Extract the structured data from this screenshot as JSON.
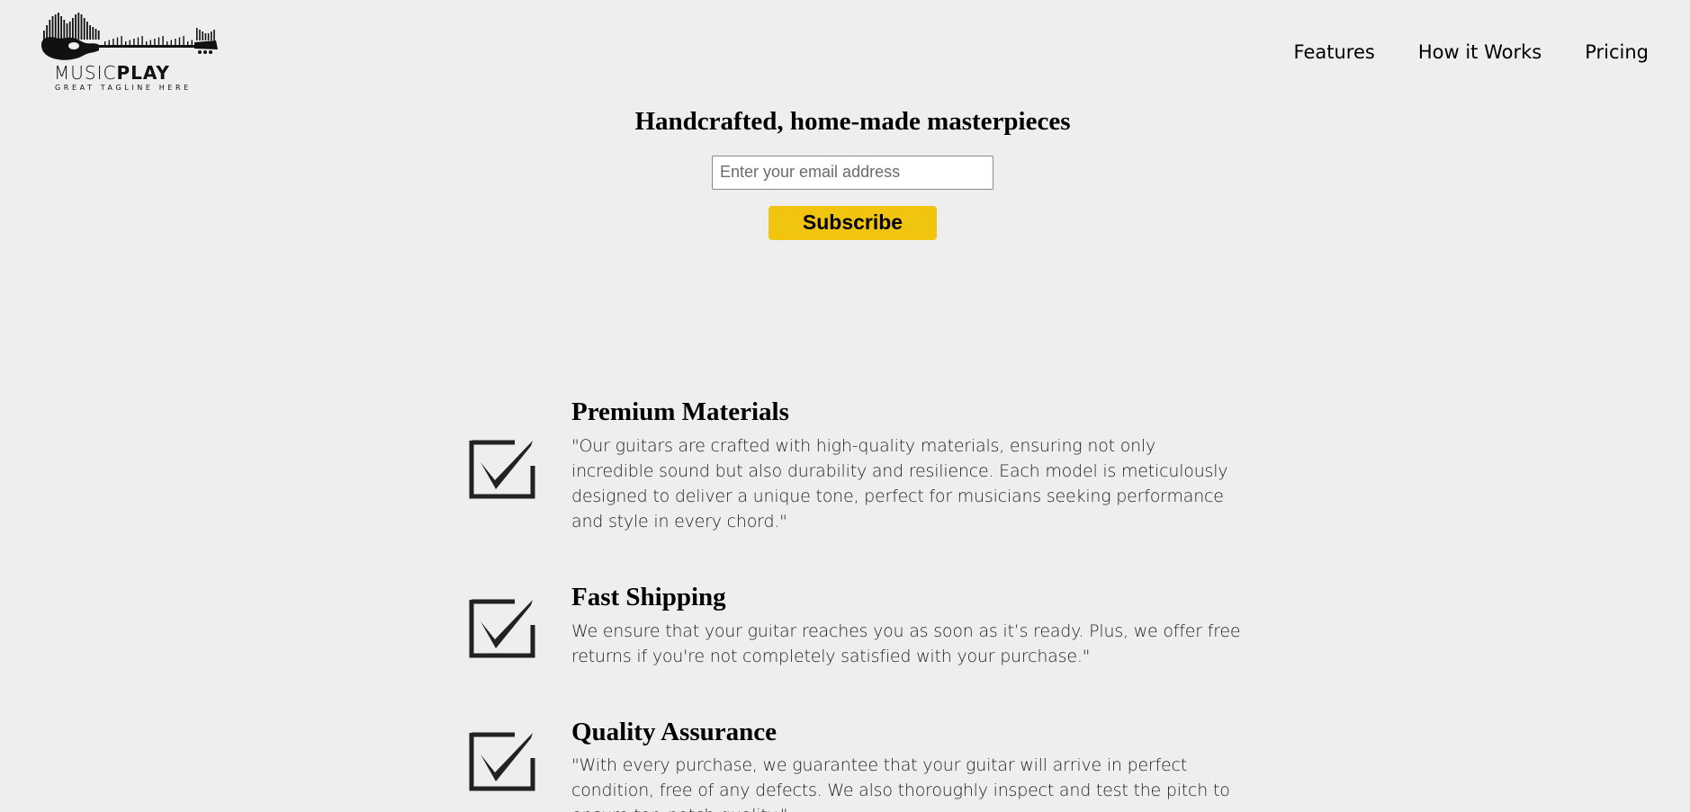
{
  "header": {
    "logo": {
      "wordmark_light": "MUSIC",
      "wordmark_bold": "PLAY",
      "tagline": "GREAT TAGLINE HERE",
      "icon": "guitar-soundwave-icon"
    },
    "nav": [
      {
        "label": "Features"
      },
      {
        "label": "How it Works"
      },
      {
        "label": "Pricing"
      }
    ]
  },
  "hero": {
    "title": "Handcrafted, home-made masterpieces",
    "email_placeholder": "Enter your email address",
    "email_value": "",
    "subscribe_label": "Subscribe",
    "subscribe_color": "#f1c40f"
  },
  "features": [
    {
      "icon": "checkbox-checked-icon",
      "title": "Premium Materials",
      "description": "\"Our guitars are crafted with high-quality materials, ensuring not only incredible sound but also durability and resilience. Each model is meticulously designed to deliver a unique tone, perfect for musicians seeking performance and style in every chord.\""
    },
    {
      "icon": "checkbox-checked-icon",
      "title": "Fast Shipping",
      "description": "We ensure that your guitar reaches you as soon as it’s ready. Plus, we offer free returns if you're not completely satisfied with your purchase.\""
    },
    {
      "icon": "checkbox-checked-icon",
      "title": "Quality Assurance",
      "description": "\"With every purchase, we guarantee that your guitar will arrive in perfect condition, free of any defects. We also thoroughly inspect and test the pitch to ensure top-notch quality.\""
    }
  ]
}
